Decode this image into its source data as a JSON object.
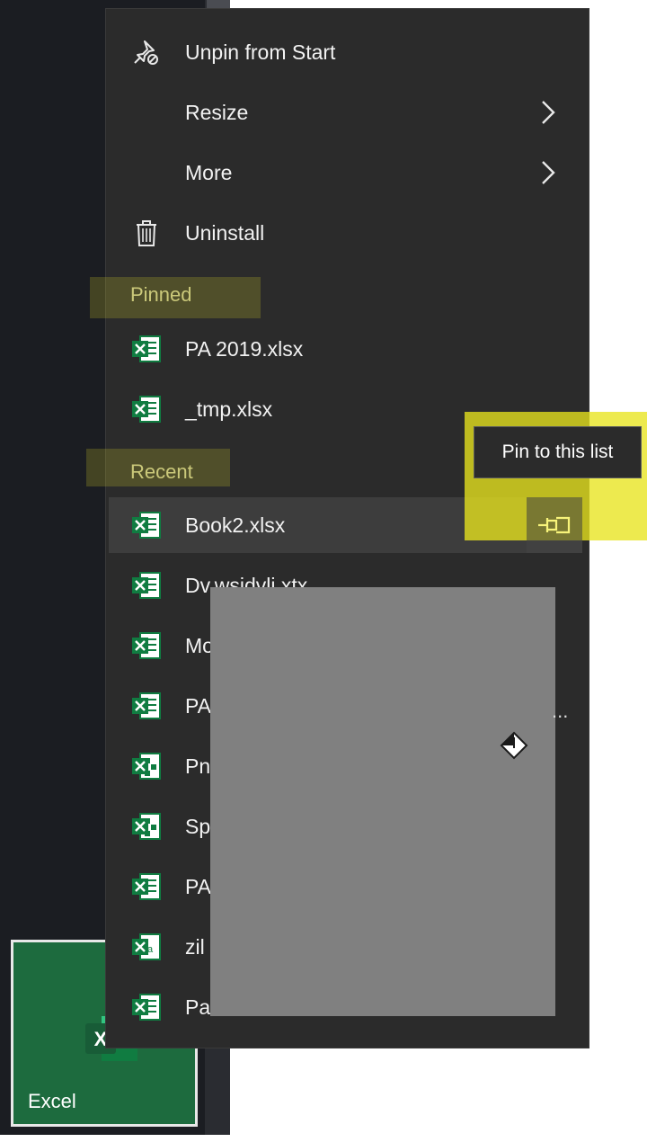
{
  "context_menu": {
    "actions": [
      {
        "label": "Unpin from Start",
        "icon": "unpin-icon"
      },
      {
        "label": "Resize",
        "icon": "chevron-right-icon"
      },
      {
        "label": "More",
        "icon": "chevron-right-icon"
      },
      {
        "label": "Uninstall",
        "icon": "trash-icon"
      }
    ],
    "pinned_header": "Pinned",
    "pinned_files": [
      {
        "name": "PA 2019.xlsx",
        "icon": "excel-file-icon"
      },
      {
        "name": "_tmp.xlsx",
        "icon": "excel-file-icon"
      }
    ],
    "recent_header": "Recent",
    "recent_files": [
      {
        "name": "Book2.xlsx",
        "icon": "excel-file-icon"
      },
      {
        "name": "Dv.wsjdvli.xtx",
        "icon": "excel-file-icon"
      },
      {
        "name": "Mo",
        "icon": "excel-file-icon"
      },
      {
        "name": "PA",
        "icon": "excel-file-icon"
      },
      {
        "name": "Pn",
        "icon": "excel-shared-file-icon"
      },
      {
        "name": "Sp",
        "icon": "excel-shared-file-icon"
      },
      {
        "name": "PAi",
        "icon": "excel-file-icon"
      },
      {
        "name": "zil",
        "icon": "excel-csv-file-icon"
      },
      {
        "name": "Pac",
        "icon": "excel-file-icon"
      }
    ],
    "recent_overflow": "..."
  },
  "tooltip": {
    "text": "Pin to this list"
  },
  "pin_button": {
    "icon": "pin-icon"
  },
  "tile": {
    "label": "Excel",
    "icon_letter": "X"
  },
  "colors": {
    "menu_bg": "#2b2b2b",
    "excel_green": "#1d6b3e",
    "highlight_yellow": "#e8e41e",
    "section_text": "#cbc97a"
  }
}
